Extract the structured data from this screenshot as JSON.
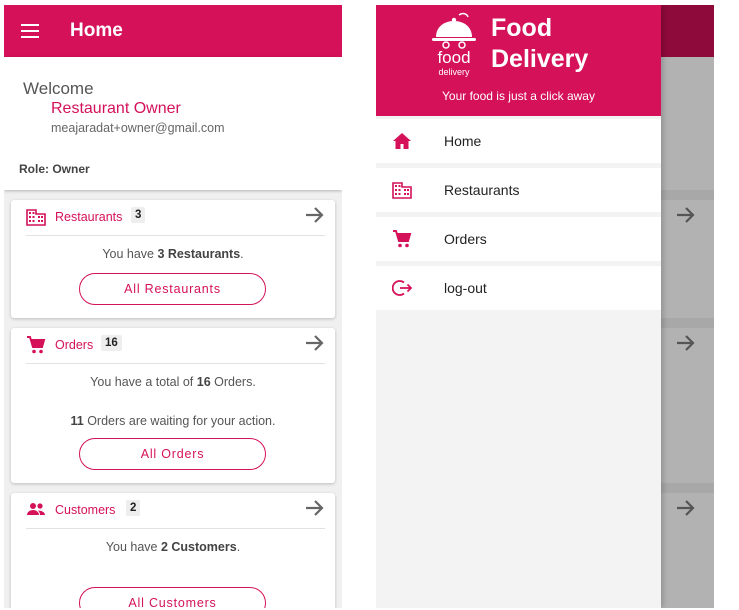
{
  "colors": {
    "primary": "#d41159",
    "primary_dark": "#8e0a3a",
    "text": "#555555"
  },
  "left": {
    "appbar": {
      "title": "Home",
      "menu_icon": "menu-icon"
    },
    "welcome": {
      "title": "Welcome",
      "name": "Restaurant Owner",
      "email": "meajaradat+owner@gmail.com",
      "role": "Role: Owner"
    },
    "cards": {
      "restaurants": {
        "label": "Restaurants",
        "count": "3",
        "line1_pre": "You have ",
        "line1_bold": "3 Restaurants",
        "line1_post": ".",
        "button": "All Restaurants",
        "icon": "building-icon"
      },
      "orders": {
        "label": "Orders",
        "count": "16",
        "line1_pre": "You have a total of ",
        "line1_bold": "16",
        "line1_post": " Orders.",
        "line2_bold": "11",
        "line2_post": " Orders are waiting for your action.",
        "button": "All Orders",
        "icon": "cart-icon"
      },
      "customers": {
        "label": "Customers",
        "count": "2",
        "line1_pre": "You have ",
        "line1_bold": "2 Customers",
        "line1_post": ".",
        "button": "All Customers",
        "icon": "people-icon"
      }
    }
  },
  "drawer": {
    "logo_top": "food",
    "logo_bottom": "delivery",
    "brand_line1": "Food",
    "brand_line2": "Delivery",
    "tagline": "Your food is just a click away",
    "items": [
      {
        "label": "Home",
        "icon": "home-icon"
      },
      {
        "label": "Restaurants",
        "icon": "building-icon"
      },
      {
        "label": "Orders",
        "icon": "cart-icon"
      },
      {
        "label": "log-out",
        "icon": "logout-icon"
      }
    ]
  }
}
